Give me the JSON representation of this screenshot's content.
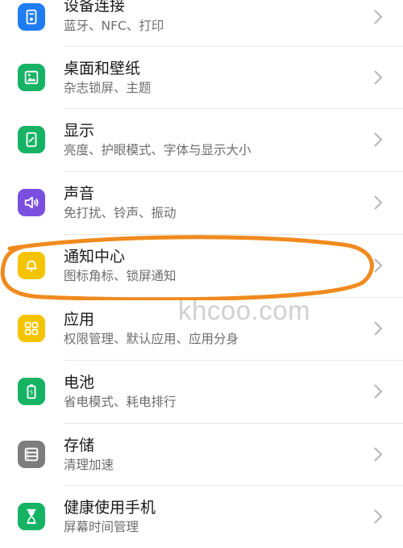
{
  "items": [
    {
      "title": "设备连接",
      "subtitle": "蓝牙、NFC、打印",
      "icon": "device-connection-icon",
      "color": "#1f7cf2"
    },
    {
      "title": "桌面和壁纸",
      "subtitle": "杂志锁屏、主题",
      "icon": "wallpaper-icon",
      "color": "#16b365"
    },
    {
      "title": "显示",
      "subtitle": "亮度、护眼模式、字体与显示大小",
      "icon": "display-icon",
      "color": "#16b365"
    },
    {
      "title": "声音",
      "subtitle": "免打扰、铃声、振动",
      "icon": "sound-icon",
      "color": "#7a4fe0"
    },
    {
      "title": "通知中心",
      "subtitle": "图标角标、锁屏通知",
      "icon": "bell-icon",
      "color": "#f5c400"
    },
    {
      "title": "应用",
      "subtitle": "权限管理、默认应用、应用分身",
      "icon": "apps-grid-icon",
      "color": "#f5c400"
    },
    {
      "title": "电池",
      "subtitle": "省电模式、耗电排行",
      "icon": "battery-icon",
      "color": "#16b365"
    },
    {
      "title": "存储",
      "subtitle": "清理加速",
      "icon": "storage-icon",
      "color": "#7d7d7d"
    },
    {
      "title": "健康使用手机",
      "subtitle": "屏幕时间管理",
      "icon": "hourglass-icon",
      "color": "#16b365"
    }
  ],
  "watermark": "khcoo.com",
  "highlight_color": "#f08a1e"
}
